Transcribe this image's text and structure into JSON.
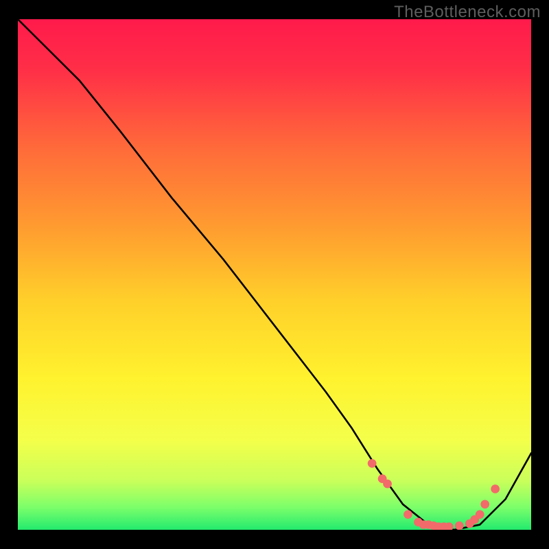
{
  "watermark": "TheBottleneck.com",
  "chart_data": {
    "type": "line",
    "title": "",
    "xlabel": "",
    "ylabel": "",
    "xlim": [
      0,
      100
    ],
    "ylim": [
      0,
      100
    ],
    "x": [
      0,
      6,
      12,
      20,
      30,
      40,
      50,
      60,
      65,
      70,
      75,
      80,
      85,
      90,
      95,
      100
    ],
    "y": [
      100,
      94,
      88,
      78,
      65,
      53,
      40,
      27,
      20,
      12,
      5,
      1,
      0,
      1,
      6,
      15
    ],
    "series": [
      {
        "name": "bottleneck-curve",
        "x": [
          0,
          6,
          12,
          20,
          30,
          40,
          50,
          60,
          65,
          70,
          75,
          80,
          85,
          90,
          95,
          100
        ],
        "y": [
          100,
          94,
          88,
          78,
          65,
          53,
          40,
          27,
          20,
          12,
          5,
          1,
          0,
          1,
          6,
          15
        ]
      }
    ],
    "markers": {
      "x": [
        69,
        71,
        72,
        76,
        78,
        79,
        80,
        81,
        82,
        83,
        84,
        86,
        88,
        89,
        90,
        91,
        93
      ],
      "y": [
        13,
        10,
        9,
        3,
        1.5,
        1,
        1,
        0.8,
        0.6,
        0.6,
        0.6,
        0.8,
        1.2,
        2,
        3,
        5,
        8
      ]
    },
    "gradient_stops": [
      {
        "offset": 0.0,
        "color": "#ff1a4b"
      },
      {
        "offset": 0.1,
        "color": "#ff2f47"
      },
      {
        "offset": 0.25,
        "color": "#ff6a3a"
      },
      {
        "offset": 0.4,
        "color": "#ff9a30"
      },
      {
        "offset": 0.55,
        "color": "#ffd02a"
      },
      {
        "offset": 0.7,
        "color": "#fff22e"
      },
      {
        "offset": 0.82,
        "color": "#f4ff4a"
      },
      {
        "offset": 0.9,
        "color": "#c9ff5a"
      },
      {
        "offset": 0.95,
        "color": "#7dff6a"
      },
      {
        "offset": 1.0,
        "color": "#19e86f"
      }
    ]
  }
}
